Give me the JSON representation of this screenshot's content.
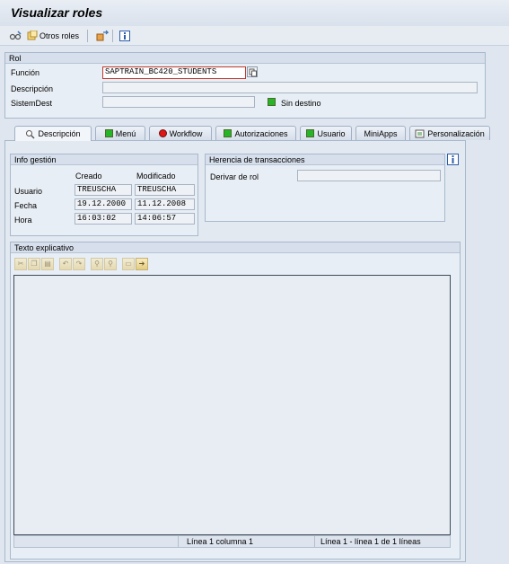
{
  "window": {
    "title": "Visualizar roles"
  },
  "toolbar": {
    "otros_roles": "Otros roles"
  },
  "rol": {
    "header": "Rol",
    "funcion_label": "Función",
    "funcion_value": "SAPTRAIN_BC420_STUDENTS",
    "descripcion_label": "Descripción",
    "descripcion_value": "",
    "sistemdest_label": "SistemDest",
    "sistemdest_value": "",
    "sin_destino": "Sin destino"
  },
  "tabs": [
    {
      "label": "Descripción",
      "icon": "description-icon"
    },
    {
      "label": "Menú",
      "icon": "green-status-icon"
    },
    {
      "label": "Workflow",
      "icon": "red-status-icon"
    },
    {
      "label": "Autorizaciones",
      "icon": "green-status-icon"
    },
    {
      "label": "Usuario",
      "icon": "green-status-icon"
    },
    {
      "label": "MiniApps",
      "icon": ""
    },
    {
      "label": "Personalización",
      "icon": "personalization-icon"
    }
  ],
  "info": {
    "header": "Info gestión",
    "col_creado": "Creado",
    "col_modificado": "Modificado",
    "rows": [
      {
        "label": "Usuario",
        "creado": "TREUSCHA",
        "modificado": "TREUSCHA"
      },
      {
        "label": "Fecha",
        "creado": "19.12.2000",
        "modificado": "11.12.2008"
      },
      {
        "label": "Hora",
        "creado": "16:03:02",
        "modificado": "14:06:57"
      }
    ]
  },
  "herencia": {
    "header": "Herencia de transacciones",
    "derivar_label": "Derivar de rol",
    "derivar_value": ""
  },
  "texto": {
    "header": "Texto explicativo",
    "status_pos": "Línea 1 columna 1",
    "status_lines": "Línea 1 - línea 1 de 1 líneas"
  },
  "colors": {
    "accent": "#26b526",
    "error": "#e01515",
    "background": "#dfe6ef"
  }
}
